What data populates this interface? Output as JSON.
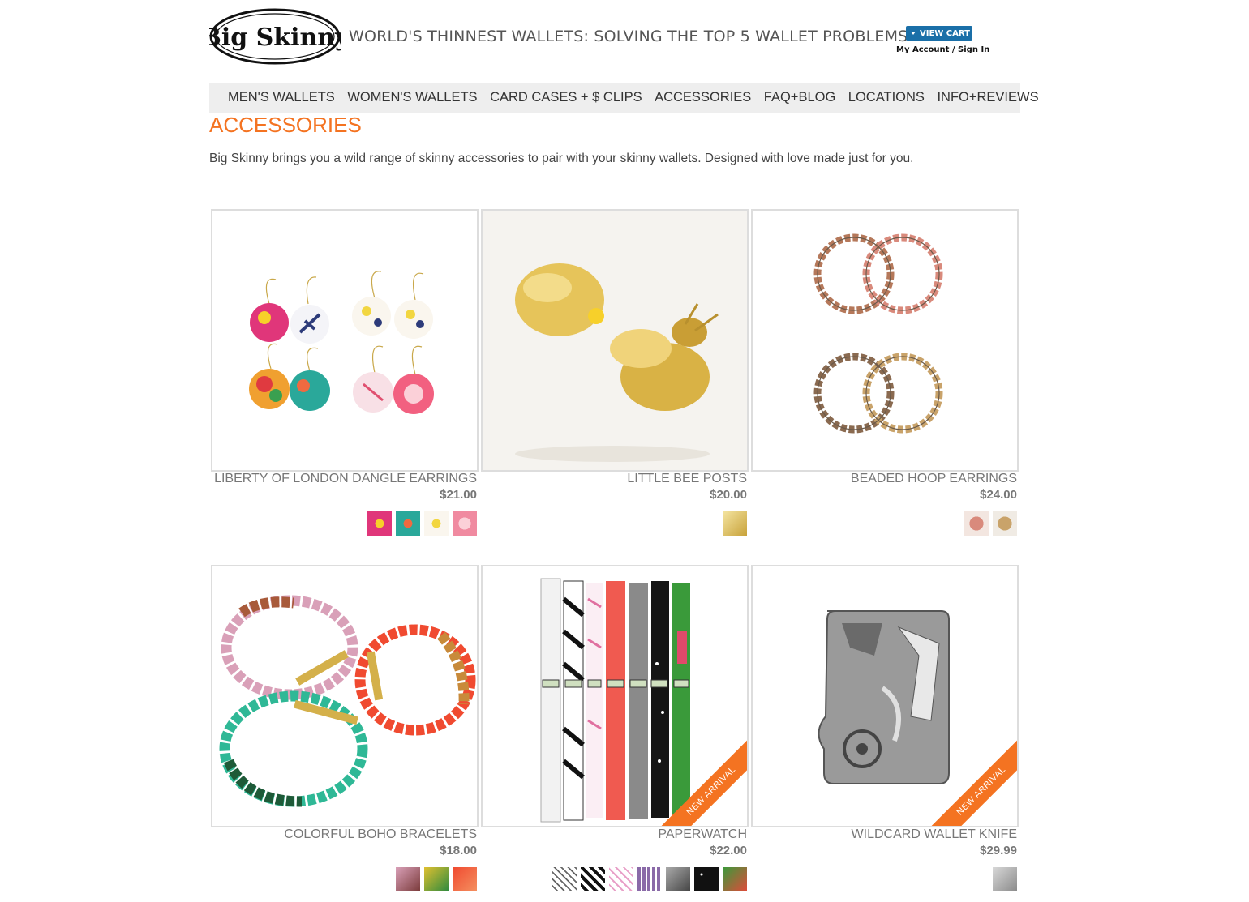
{
  "header": {
    "brand": "Big Skinny",
    "tagline": "WORLD'S THINNEST WALLETS: SOLVING THE TOP 5 WALLET PROBLEMS",
    "view_cart": "VIEW CART",
    "account": "My Account / Sign In"
  },
  "nav": [
    "MEN'S WALLETS",
    "WOMEN'S WALLETS",
    "CARD CASES + $ CLIPS",
    "ACCESSORIES",
    "FAQ+BLOG",
    "LOCATIONS",
    "INFO+REVIEWS"
  ],
  "page": {
    "title": "ACCESSORIES",
    "intro": "Big Skinny brings you a wild range of skinny accessories to pair with your skinny wallets. Designed with love made just for you."
  },
  "colors": {
    "accent": "#f47321",
    "cart_blue": "#1a6fa8",
    "nav_bg": "#eeeeee"
  },
  "products": [
    {
      "name": "LIBERTY OF LONDON DANGLE EARRINGS",
      "price": "$21.00",
      "image": "floral-earrings-image",
      "swatches": [
        "#e0367a",
        "#2aa89a",
        "#f2d640",
        "#f08aa0"
      ],
      "badge": ""
    },
    {
      "name": "LITTLE BEE POSTS",
      "price": "$20.00",
      "image": "gold-bee-earrings-image",
      "swatches": [
        "#d4b04a"
      ],
      "badge": ""
    },
    {
      "name": "BEADED HOOP EARRINGS",
      "price": "$24.00",
      "image": "beaded-hoop-earrings-image",
      "swatches": [
        "#d98a7c",
        "#c9a36a"
      ],
      "badge": ""
    },
    {
      "name": "COLORFUL BOHO BRACELETS",
      "price": "$18.00",
      "image": "boho-bracelets-image",
      "swatches": [
        "#d9a0b8",
        "#2e8a3e",
        "#f04a30"
      ],
      "badge": ""
    },
    {
      "name": "PAPERWATCH",
      "price": "$22.00",
      "image": "paperwatch-image",
      "swatches": [
        "#dddddd",
        "#222222",
        "#e8a0c8",
        "#8a6aa8",
        "#6a6a6a",
        "#111111",
        "#3a9a3a"
      ],
      "badge": "NEW ARRIVAL"
    },
    {
      "name": "WILDCARD WALLET KNIFE",
      "price": "$29.99",
      "image": "wallet-knife-image",
      "swatches": [
        "#a8a8a8"
      ],
      "badge": "NEW ARRIVAL"
    }
  ]
}
